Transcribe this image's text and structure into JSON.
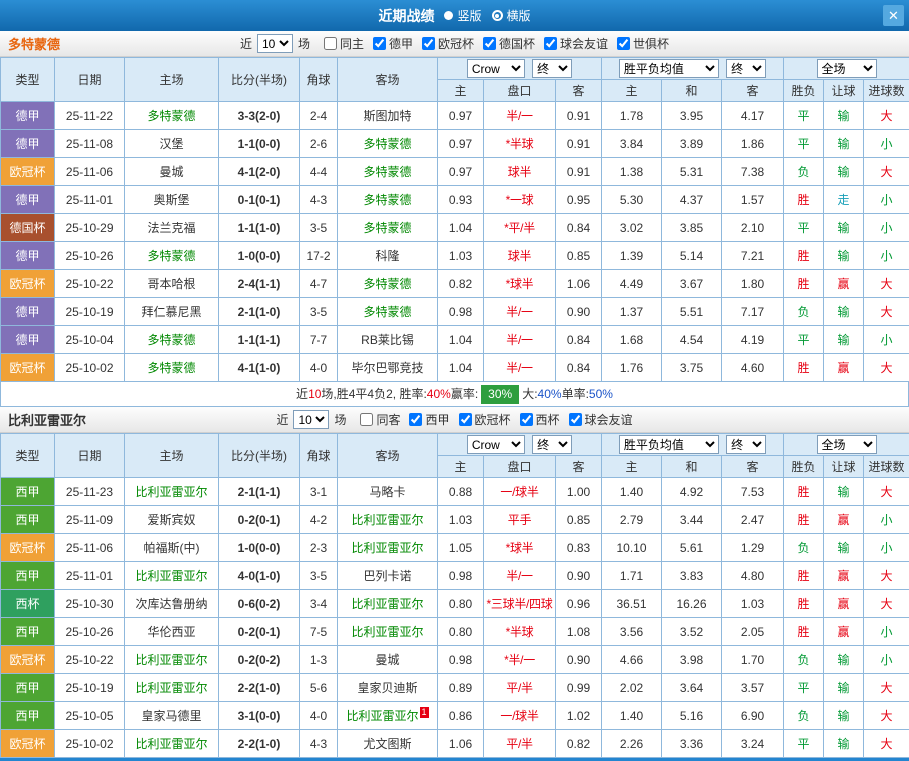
{
  "titlebar": {
    "title": "近期战绩",
    "radios": [
      {
        "label": "竖版",
        "selected": false
      },
      {
        "label": "横版",
        "selected": true
      }
    ],
    "close_icon": "✕"
  },
  "table_header": {
    "main_columns": [
      "类型",
      "日期",
      "主场",
      "比分(半场)",
      "角球",
      "客场"
    ],
    "dropdowns": [
      "Crow",
      "终",
      "胜平负均值",
      "终",
      "全场"
    ],
    "sub_columns": [
      "主",
      "盘口",
      "客",
      "主",
      "和",
      "客",
      "胜负",
      "让球",
      "进球数"
    ]
  },
  "colors": {
    "red": "#e60012",
    "green": "#009933",
    "blue": "#1a53c8",
    "teal": "#18a0b8",
    "team_green": "#008800",
    "summary_box_bg": "#2e9e3e",
    "type_badges": {
      "德甲": "#8171b8",
      "欧冠杯": "#f0a137",
      "德国杯": "#a8502e",
      "西甲": "#4da533",
      "西杯": "#2fa05f"
    }
  },
  "result_color_map": {
    "胜": "red",
    "平": "green",
    "负": "green",
    "赢": "red",
    "输": "green",
    "走": "teal",
    "大": "red",
    "小": "green"
  },
  "sections": [
    {
      "team": "多特蒙德",
      "team_color": "#e8650f",
      "filters": {
        "near_label": "近",
        "count": "10",
        "games_label": "场",
        "checkboxes": [
          {
            "label": "同主",
            "checked": false
          },
          {
            "label": "德甲",
            "checked": true
          },
          {
            "label": "欧冠杯",
            "checked": true
          },
          {
            "label": "德国杯",
            "checked": true
          },
          {
            "label": "球会友谊",
            "checked": true
          },
          {
            "label": "世俱杯",
            "checked": true
          }
        ]
      },
      "rows": [
        {
          "type": "德甲",
          "date": "25-11-22",
          "home": "多特蒙德",
          "home_is_team": true,
          "score": "3-3(2-0)",
          "corner": "2-4",
          "away": "斯图加特",
          "away_is_team": false,
          "ah_home": "0.97",
          "handicap": "半/一",
          "ah_away": "0.91",
          "eu_home": "1.78",
          "eu_draw": "3.95",
          "eu_away": "4.17",
          "result": "平",
          "ah_result": "输",
          "ou_result": "大"
        },
        {
          "type": "德甲",
          "date": "25-11-08",
          "home": "汉堡",
          "home_is_team": false,
          "score": "1-1(0-0)",
          "corner": "2-6",
          "away": "多特蒙德",
          "away_is_team": true,
          "ah_home": "0.97",
          "handicap": "*半球",
          "ah_away": "0.91",
          "eu_home": "3.84",
          "eu_draw": "3.89",
          "eu_away": "1.86",
          "result": "平",
          "ah_result": "输",
          "ou_result": "小"
        },
        {
          "type": "欧冠杯",
          "date": "25-11-06",
          "home": "曼城",
          "home_is_team": false,
          "score": "4-1(2-0)",
          "corner": "4-4",
          "away": "多特蒙德",
          "away_is_team": true,
          "ah_home": "0.97",
          "handicap": "球半",
          "ah_away": "0.91",
          "eu_home": "1.38",
          "eu_draw": "5.31",
          "eu_away": "7.38",
          "result": "负",
          "ah_result": "输",
          "ou_result": "大"
        },
        {
          "type": "德甲",
          "date": "25-11-01",
          "home": "奥斯堡",
          "home_is_team": false,
          "score": "0-1(0-1)",
          "corner": "4-3",
          "away": "多特蒙德",
          "away_is_team": true,
          "ah_home": "0.93",
          "handicap": "*一球",
          "ah_away": "0.95",
          "eu_home": "5.30",
          "eu_draw": "4.37",
          "eu_away": "1.57",
          "result": "胜",
          "ah_result": "走",
          "ou_result": "小"
        },
        {
          "type": "德国杯",
          "date": "25-10-29",
          "home": "法兰克福",
          "home_is_team": false,
          "score": "1-1(1-0)",
          "corner": "3-5",
          "away": "多特蒙德",
          "away_is_team": true,
          "ah_home": "1.04",
          "handicap": "*平/半",
          "ah_away": "0.84",
          "eu_home": "3.02",
          "eu_draw": "3.85",
          "eu_away": "2.10",
          "result": "平",
          "ah_result": "输",
          "ou_result": "小"
        },
        {
          "type": "德甲",
          "date": "25-10-26",
          "home": "多特蒙德",
          "home_is_team": true,
          "score": "1-0(0-0)",
          "corner": "17-2",
          "away": "科隆",
          "away_is_team": false,
          "ah_home": "1.03",
          "handicap": "球半",
          "ah_away": "0.85",
          "eu_home": "1.39",
          "eu_draw": "5.14",
          "eu_away": "7.21",
          "result": "胜",
          "ah_result": "输",
          "ou_result": "小"
        },
        {
          "type": "欧冠杯",
          "date": "25-10-22",
          "home": "哥本哈根",
          "home_is_team": false,
          "score": "2-4(1-1)",
          "corner": "4-7",
          "away": "多特蒙德",
          "away_is_team": true,
          "ah_home": "0.82",
          "handicap": "*球半",
          "ah_away": "1.06",
          "eu_home": "4.49",
          "eu_draw": "3.67",
          "eu_away": "1.80",
          "result": "胜",
          "ah_result": "赢",
          "ou_result": "大"
        },
        {
          "type": "德甲",
          "date": "25-10-19",
          "home": "拜仁慕尼黑",
          "home_is_team": false,
          "score": "2-1(1-0)",
          "corner": "3-5",
          "away": "多特蒙德",
          "away_is_team": true,
          "ah_home": "0.98",
          "handicap": "半/一",
          "ah_away": "0.90",
          "eu_home": "1.37",
          "eu_draw": "5.51",
          "eu_away": "7.17",
          "result": "负",
          "ah_result": "输",
          "ou_result": "大"
        },
        {
          "type": "德甲",
          "date": "25-10-04",
          "home": "多特蒙德",
          "home_is_team": true,
          "score": "1-1(1-1)",
          "corner": "7-7",
          "away": "RB莱比锡",
          "away_is_team": false,
          "ah_home": "1.04",
          "handicap": "半/一",
          "ah_away": "0.84",
          "eu_home": "1.68",
          "eu_draw": "4.54",
          "eu_away": "4.19",
          "result": "平",
          "ah_result": "输",
          "ou_result": "小"
        },
        {
          "type": "欧冠杯",
          "date": "25-10-02",
          "home": "多特蒙德",
          "home_is_team": true,
          "score": "4-1(1-0)",
          "corner": "4-0",
          "away": "毕尔巴鄂竞技",
          "away_is_team": false,
          "ah_home": "1.04",
          "handicap": "半/一",
          "ah_away": "0.84",
          "eu_home": "1.76",
          "eu_draw": "3.75",
          "eu_away": "4.60",
          "result": "胜",
          "ah_result": "赢",
          "ou_result": "大"
        }
      ],
      "summary": [
        {
          "text": "近"
        },
        {
          "text": "10",
          "color": "red"
        },
        {
          "text": "场,胜4平4负2, 胜率:"
        },
        {
          "text": "40%",
          "color": "red"
        },
        {
          "text": "赢率:"
        },
        {
          "text": "30%",
          "box": true
        },
        {
          "text": "大:"
        },
        {
          "text": "40%",
          "color": "blue"
        },
        {
          "text": "单率:"
        },
        {
          "text": "50%",
          "color": "blue"
        }
      ]
    },
    {
      "team": "比利亚雷亚尔",
      "team_color": "#333333",
      "filters": {
        "near_label": "近",
        "count": "10",
        "games_label": "场",
        "checkboxes": [
          {
            "label": "同客",
            "checked": false
          },
          {
            "label": "西甲",
            "checked": true
          },
          {
            "label": "欧冠杯",
            "checked": true
          },
          {
            "label": "西杯",
            "checked": true
          },
          {
            "label": "球会友谊",
            "checked": true
          }
        ]
      },
      "rows": [
        {
          "type": "西甲",
          "date": "25-11-23",
          "home": "比利亚雷亚尔",
          "home_is_team": true,
          "score": "2-1(1-1)",
          "corner": "3-1",
          "away": "马略卡",
          "away_is_team": false,
          "ah_home": "0.88",
          "handicap": "一/球半",
          "ah_away": "1.00",
          "eu_home": "1.40",
          "eu_draw": "4.92",
          "eu_away": "7.53",
          "result": "胜",
          "ah_result": "输",
          "ou_result": "大"
        },
        {
          "type": "西甲",
          "date": "25-11-09",
          "home": "爱斯宾奴",
          "home_is_team": false,
          "score": "0-2(0-1)",
          "corner": "4-2",
          "away": "比利亚雷亚尔",
          "away_is_team": true,
          "ah_home": "1.03",
          "handicap": "平手",
          "ah_away": "0.85",
          "eu_home": "2.79",
          "eu_draw": "3.44",
          "eu_away": "2.47",
          "result": "胜",
          "ah_result": "赢",
          "ou_result": "小"
        },
        {
          "type": "欧冠杯",
          "date": "25-11-06",
          "home": "帕福斯(中)",
          "home_is_team": false,
          "score": "1-0(0-0)",
          "corner": "2-3",
          "away": "比利亚雷亚尔",
          "away_is_team": true,
          "ah_home": "1.05",
          "handicap": "*球半",
          "ah_away": "0.83",
          "eu_home": "10.10",
          "eu_draw": "5.61",
          "eu_away": "1.29",
          "result": "负",
          "ah_result": "输",
          "ou_result": "小"
        },
        {
          "type": "西甲",
          "date": "25-11-01",
          "home": "比利亚雷亚尔",
          "home_is_team": true,
          "score": "4-0(1-0)",
          "corner": "3-5",
          "away": "巴列卡诺",
          "away_is_team": false,
          "ah_home": "0.98",
          "handicap": "半/一",
          "ah_away": "0.90",
          "eu_home": "1.71",
          "eu_draw": "3.83",
          "eu_away": "4.80",
          "result": "胜",
          "ah_result": "赢",
          "ou_result": "大"
        },
        {
          "type": "西杯",
          "date": "25-10-30",
          "home": "次库达鲁册纳",
          "home_is_team": false,
          "score": "0-6(0-2)",
          "corner": "3-4",
          "away": "比利亚雷亚尔",
          "away_is_team": true,
          "ah_home": "0.80",
          "handicap": "*三球半/四球",
          "ah_away": "0.96",
          "eu_home": "36.51",
          "eu_draw": "16.26",
          "eu_away": "1.03",
          "result": "胜",
          "ah_result": "赢",
          "ou_result": "大"
        },
        {
          "type": "西甲",
          "date": "25-10-26",
          "home": "华伦西亚",
          "home_is_team": false,
          "score": "0-2(0-1)",
          "corner": "7-5",
          "away": "比利亚雷亚尔",
          "away_is_team": true,
          "ah_home": "0.80",
          "handicap": "*半球",
          "ah_away": "1.08",
          "eu_home": "3.56",
          "eu_draw": "3.52",
          "eu_away": "2.05",
          "result": "胜",
          "ah_result": "赢",
          "ou_result": "小"
        },
        {
          "type": "欧冠杯",
          "date": "25-10-22",
          "home": "比利亚雷亚尔",
          "home_is_team": true,
          "score": "0-2(0-2)",
          "corner": "1-3",
          "away": "曼城",
          "away_is_team": false,
          "ah_home": "0.98",
          "handicap": "*半/一",
          "ah_away": "0.90",
          "eu_home": "4.66",
          "eu_draw": "3.98",
          "eu_away": "1.70",
          "result": "负",
          "ah_result": "输",
          "ou_result": "小"
        },
        {
          "type": "西甲",
          "date": "25-10-19",
          "home": "比利亚雷亚尔",
          "home_is_team": true,
          "score": "2-2(1-0)",
          "corner": "5-6",
          "away": "皇家贝迪斯",
          "away_is_team": false,
          "ah_home": "0.89",
          "handicap": "平/半",
          "ah_away": "0.99",
          "eu_home": "2.02",
          "eu_draw": "3.64",
          "eu_away": "3.57",
          "result": "平",
          "ah_result": "输",
          "ou_result": "大"
        },
        {
          "type": "西甲",
          "date": "25-10-05",
          "home": "皇家马德里",
          "home_is_team": false,
          "score": "3-1(0-0)",
          "corner": "4-0",
          "away": "比利亚雷亚尔",
          "away_is_team": true,
          "away_sup": "1",
          "ah_home": "0.86",
          "handicap": "一/球半",
          "ah_away": "1.02",
          "eu_home": "1.40",
          "eu_draw": "5.16",
          "eu_away": "6.90",
          "result": "负",
          "ah_result": "输",
          "ou_result": "大"
        },
        {
          "type": "欧冠杯",
          "date": "25-10-02",
          "home": "比利亚雷亚尔",
          "home_is_team": true,
          "score": "2-2(1-0)",
          "corner": "4-3",
          "away": "尤文图斯",
          "away_is_team": false,
          "ah_home": "1.06",
          "handicap": "平/半",
          "ah_away": "0.82",
          "eu_home": "2.26",
          "eu_draw": "3.36",
          "eu_away": "3.24",
          "result": "平",
          "ah_result": "输",
          "ou_result": "大"
        }
      ]
    }
  ]
}
